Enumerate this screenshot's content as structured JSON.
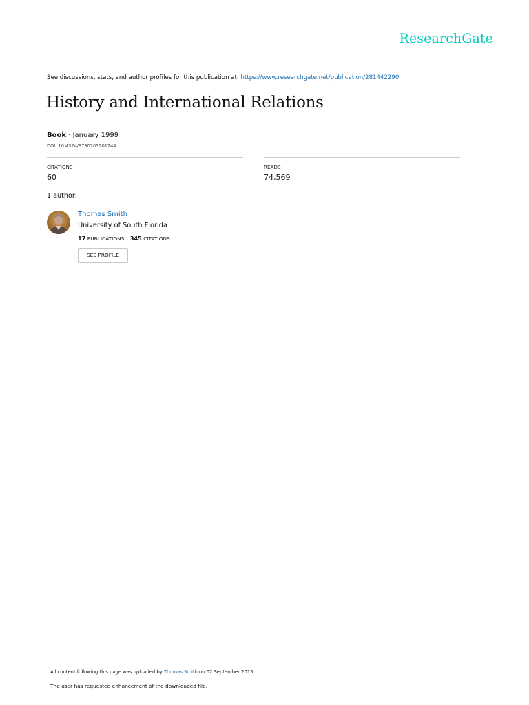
{
  "brand": {
    "logo_text": "ResearchGate",
    "accent_color": "#00ccbb",
    "link_color": "#1f6fb2"
  },
  "header": {
    "see_text": "See discussions, stats, and author profiles for this publication at:",
    "publication_url": "https://www.researchgate.net/publication/281442290"
  },
  "publication": {
    "title": "History and International Relations",
    "type": "Book",
    "separator": " · ",
    "date": "January 1999",
    "doi": "DOI: 10.4324/9780203201244"
  },
  "stats": {
    "citations_label": "CITATIONS",
    "citations_value": "60",
    "reads_label": "READS",
    "reads_value": "74,569"
  },
  "authors": {
    "count_label": "1 author:",
    "list": [
      {
        "name": "Thomas Smith",
        "institution": "University of South Florida",
        "publications_count": "17",
        "publications_label": "PUBLICATIONS",
        "citations_count": "345",
        "citations_label": "CITATIONS",
        "profile_button": "SEE PROFILE"
      }
    ]
  },
  "footer": {
    "upload_prefix": "All content following this page was uploaded by",
    "uploader": "Thomas Smith",
    "upload_suffix": "on 02 September 2015.",
    "note": "The user has requested enhancement of the downloaded file."
  }
}
